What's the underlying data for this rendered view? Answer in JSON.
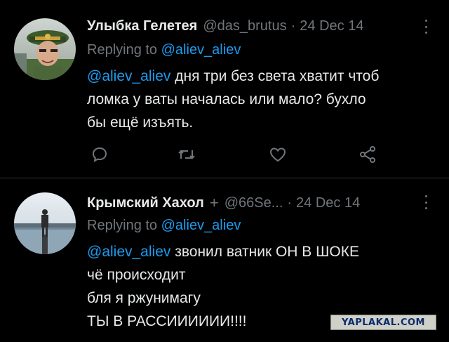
{
  "tweets": [
    {
      "author_name": "Улыбка Гелетея",
      "handle": "@das_brutus",
      "separator": "·",
      "date": "24 Dec 14",
      "replying_prefix": "Replying to",
      "replying_to": "@aliev_aliev",
      "mention": "@aliev_aliev",
      "body_lines": [
        " дня три без света хватит чтоб",
        "ломка у ваты началась или мало? бухло",
        "бы ещё изъять."
      ]
    },
    {
      "author_name": "Крымский Хахол",
      "badge": "+",
      "handle": "@66Se...",
      "separator": "·",
      "date": "24 Dec 14",
      "replying_prefix": "Replying to",
      "replying_to": "@aliev_aliev",
      "mention": "@aliev_aliev",
      "body_lines": [
        " звонил ватник ОН В ШОКЕ",
        "чё происходит",
        "бля я ржунимагу",
        "ТЫ В РАССИИИИИИ!!!!"
      ]
    }
  ],
  "actions": {
    "reply_icon": "speech-bubble-icon",
    "retweet_icon": "retweet-icon",
    "like_icon": "heart-icon",
    "share_icon": "share-icon"
  },
  "colors": {
    "background": "#000000",
    "text": "#e7e9ea",
    "muted": "#71767b",
    "link": "#1d9bf0",
    "divider": "#2f3336"
  },
  "watermark": "YAPLAKAL.COM"
}
